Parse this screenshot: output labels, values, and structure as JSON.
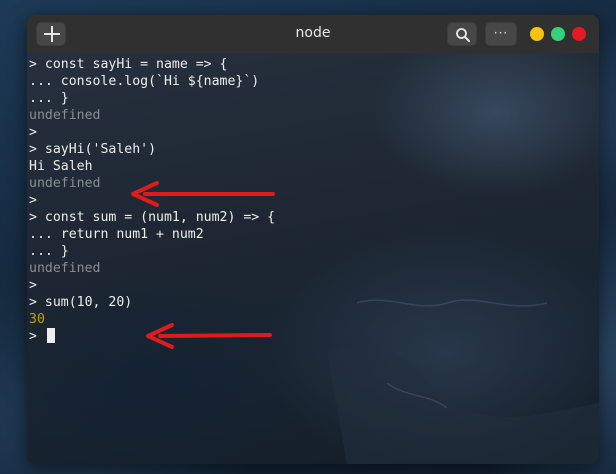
{
  "window": {
    "title": "node"
  },
  "toolbar": {
    "new_tab_icon": "plus-icon",
    "search_icon": "search-icon",
    "menu_icon": "ellipsis-icon",
    "menu_label": "···"
  },
  "window_controls": {
    "minimize_color": "#f5c211",
    "maximize_color": "#33d17a",
    "close_color": "#e01b24"
  },
  "terminal": {
    "lines": [
      "> const sayHi = name => {",
      "... console.log(`Hi ${name}`)",
      "... }",
      "undefined",
      ">",
      "> sayHi('Saleh')",
      "Hi Saleh",
      "undefined",
      ">",
      "> const sum = (num1, num2) => {",
      "... return num1 + num2",
      "... }",
      "undefined",
      ">",
      "> sum(10, 20)",
      "30",
      ">"
    ]
  },
  "annotations": {
    "arrow_color": "#e01b1b"
  }
}
